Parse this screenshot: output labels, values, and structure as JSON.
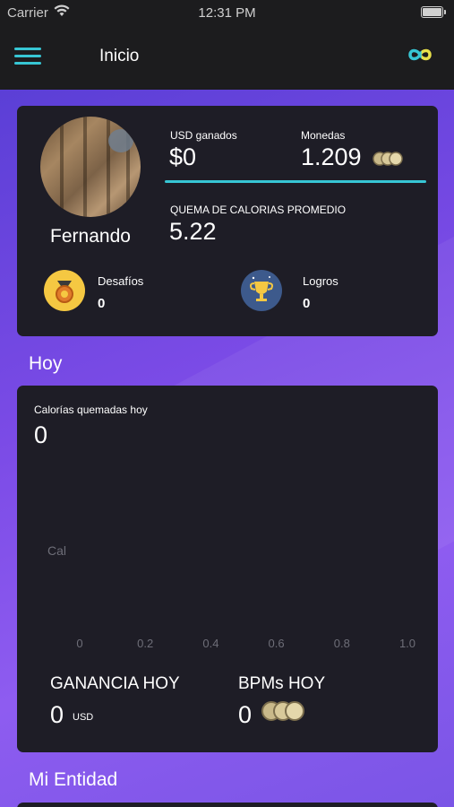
{
  "status_bar": {
    "carrier": "Carrier",
    "time": "12:31 PM"
  },
  "nav": {
    "title": "Inicio"
  },
  "profile": {
    "name": "Fernando",
    "usd_label": "USD ganados",
    "usd_value": "$0",
    "coins_label": "Monedas",
    "coins_value": "1.209",
    "calories_label": "QUEMA DE CALORIAS PROMEDIO",
    "calories_value": "5.22",
    "challenges_label": "Desafíos",
    "challenges_value": "0",
    "achievements_label": "Logros",
    "achievements_value": "0"
  },
  "today": {
    "section_title": "Hoy",
    "calories_label": "Calorías quemadas hoy",
    "calories_value": "0",
    "gain_label": "GANANCIA HOY",
    "gain_value": "0",
    "gain_unit": "USD",
    "bpm_label": "BPMs HOY",
    "bpm_value": "0"
  },
  "chart_data": {
    "type": "line",
    "ylabel": "Cal",
    "xticks": [
      "0",
      "0.2",
      "0.4",
      "0.6",
      "0.8",
      "1.0"
    ],
    "series": []
  },
  "entity": {
    "section_title": "Mi Entidad"
  },
  "colors": {
    "accent": "#37c6d4",
    "card": "#1e1d26",
    "background_gradient_start": "#5b3fd6",
    "background_gradient_end": "#8e5cf0"
  }
}
